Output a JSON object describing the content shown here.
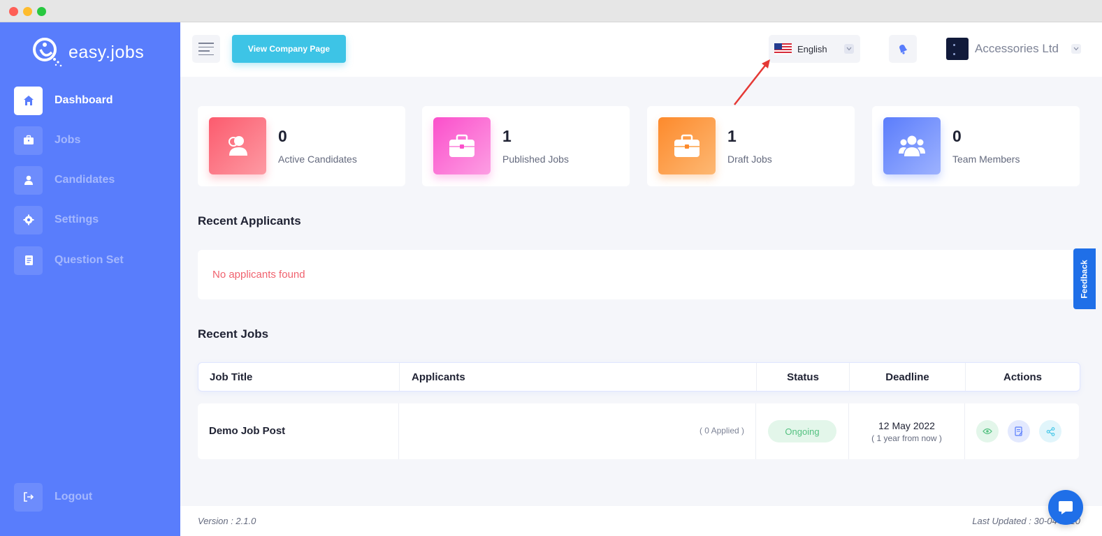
{
  "app": {
    "logo_text": "easy.jobs"
  },
  "sidebar": {
    "items": [
      {
        "label": "Dashboard",
        "icon": "home-icon",
        "active": true
      },
      {
        "label": "Jobs",
        "icon": "briefcase-icon",
        "active": false
      },
      {
        "label": "Candidates",
        "icon": "user-icon",
        "active": false
      },
      {
        "label": "Settings",
        "icon": "gear-icon",
        "active": false
      },
      {
        "label": "Question Set",
        "icon": "document-icon",
        "active": false
      }
    ],
    "logout_label": "Logout"
  },
  "topbar": {
    "view_company_label": "View Company Page",
    "language": "English",
    "company_name": "Accessories Ltd"
  },
  "stats": [
    {
      "value": "0",
      "label": "Active Candidates",
      "color": "#fc6b7a"
    },
    {
      "value": "1",
      "label": "Published Jobs",
      "color": "#fb5fd0"
    },
    {
      "value": "1",
      "label": "Draft Jobs",
      "color": "#fd9a3c"
    },
    {
      "value": "0",
      "label": "Team Members",
      "color": "#6b8bfd"
    }
  ],
  "recent_applicants": {
    "title": "Recent Applicants",
    "empty_text": "No applicants found"
  },
  "recent_jobs": {
    "title": "Recent Jobs",
    "columns": [
      "Job Title",
      "Applicants",
      "Status",
      "Deadline",
      "Actions"
    ],
    "rows": [
      {
        "title": "Demo Job Post",
        "applicants": "( 0 Applied )",
        "status": "Ongoing",
        "deadline": "12 May 2022",
        "deadline_relative": "( 1 year from now )"
      }
    ]
  },
  "footer": {
    "version": "Version : 2.1.0",
    "last_updated": "Last Updated : 30-04-2020"
  },
  "feedback_label": "Feedback",
  "colors": {
    "sidebar": "#597dfc",
    "accent_button": "#3dc4e6",
    "status_ongoing": "#54c180",
    "empty_text": "#f0626e"
  }
}
